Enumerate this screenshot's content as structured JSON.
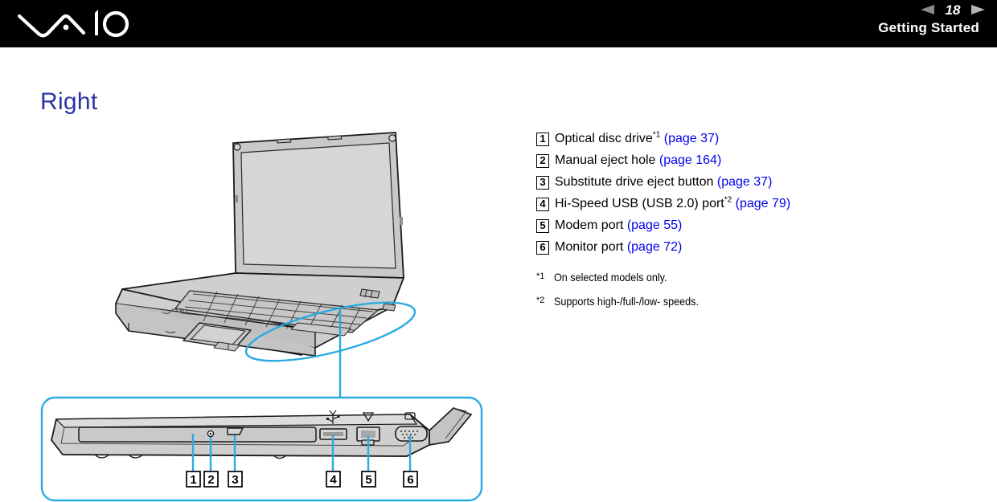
{
  "header": {
    "logo_name": "vaio-logo",
    "prev_icon": "triangle-left-icon",
    "next_icon": "triangle-right-icon",
    "page_number": "18",
    "section_title": "Getting Started"
  },
  "page": {
    "heading": "Right"
  },
  "legend": {
    "items": [
      {
        "num": "1",
        "label": "Optical disc drive",
        "sup": "*1",
        "link": "(page 37)"
      },
      {
        "num": "2",
        "label": "Manual eject hole",
        "sup": "",
        "link": "(page 164)"
      },
      {
        "num": "3",
        "label": "Substitute drive eject button",
        "sup": "",
        "link": "(page 37)"
      },
      {
        "num": "4",
        "label": "Hi-Speed USB (USB 2.0) port",
        "sup": "*2",
        "link": "(page 79)"
      },
      {
        "num": "5",
        "label": "Modem port",
        "sup": "",
        "link": "(page 55)"
      },
      {
        "num": "6",
        "label": "Monitor port",
        "sup": "",
        "link": "(page 72)"
      }
    ]
  },
  "footnotes": [
    {
      "mark": "*1",
      "text": "On selected models only."
    },
    {
      "mark": "*2",
      "text": "Supports high-/full-/low- speeds."
    }
  ],
  "illustration": {
    "laptop_name": "laptop-open-view",
    "callout_ellipse_name": "callout-ellipse-right-edge",
    "connector_name": "callout-connector-line",
    "detail_panel_name": "right-side-detail-panel",
    "callouts": [
      {
        "num": "1",
        "target": "optical-disc-drive"
      },
      {
        "num": "2",
        "target": "manual-eject-hole"
      },
      {
        "num": "3",
        "target": "substitute-drive-eject-button"
      },
      {
        "num": "4",
        "target": "usb-port"
      },
      {
        "num": "5",
        "target": "modem-port"
      },
      {
        "num": "6",
        "target": "monitor-port"
      }
    ],
    "port_icons": [
      {
        "name": "usb-icon"
      },
      {
        "name": "modem-phone-icon"
      },
      {
        "name": "monitor-icon"
      }
    ]
  },
  "colors": {
    "accent_cyan": "#29abe2",
    "heading_blue": "#2b35a8",
    "link_blue": "#0000ee",
    "header_black": "#000000",
    "body_gray": "#d2d2d2"
  }
}
